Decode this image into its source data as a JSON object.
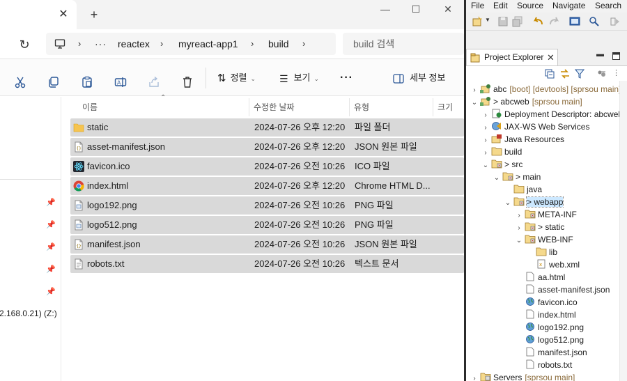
{
  "explorer": {
    "close_tab": "✕",
    "new_tab": "+",
    "window": {
      "minimize": "—",
      "maximize": "☐",
      "close": "✕"
    },
    "refresh": "↻",
    "breadcrumb": [
      "reactex",
      "myreact-app1",
      "build"
    ],
    "ellipsis": "···",
    "search_placeholder": "build 검색",
    "toolbar": {
      "sort": "정렬",
      "view": "보기",
      "more": "···",
      "details": "세부 정보"
    },
    "columns": {
      "name": "이름",
      "date": "수정한 날짜",
      "type": "유형",
      "size": "크기"
    },
    "files": [
      {
        "icon": "folder-icon",
        "name": "static",
        "date": "2024-07-26 오후 12:20",
        "type": "파일 폴더"
      },
      {
        "icon": "json-file-icon",
        "name": "asset-manifest.json",
        "date": "2024-07-26 오후 12:20",
        "type": "JSON 원본 파일"
      },
      {
        "icon": "react-icon",
        "name": "favicon.ico",
        "date": "2024-07-26 오전 10:26",
        "type": "ICO 파일"
      },
      {
        "icon": "chrome-icon",
        "name": "index.html",
        "date": "2024-07-26 오후 12:20",
        "type": "Chrome HTML D..."
      },
      {
        "icon": "image-file-icon",
        "name": "logo192.png",
        "date": "2024-07-26 오전 10:26",
        "type": "PNG 파일"
      },
      {
        "icon": "image-file-icon",
        "name": "logo512.png",
        "date": "2024-07-26 오전 10:26",
        "type": "PNG 파일"
      },
      {
        "icon": "json-file-icon",
        "name": "manifest.json",
        "date": "2024-07-26 오전 10:26",
        "type": "JSON 원본 파일"
      },
      {
        "icon": "text-file-icon",
        "name": "robots.txt",
        "date": "2024-07-26 오전 10:26",
        "type": "텍스트 문서"
      }
    ],
    "nav_drive": "2.168.0.21) (Z:)"
  },
  "eclipse": {
    "menu": [
      "File",
      "Edit",
      "Source",
      "Navigate",
      "Search"
    ],
    "view_title": "Project Explorer",
    "view_close": "✕",
    "tree": [
      {
        "indent": 0,
        "twisty": "›",
        "icon": "project-icon",
        "label": "abc",
        "decor": "[boot] [devtools] [sprsou main]"
      },
      {
        "indent": 0,
        "twisty": "⌄",
        "icon": "project-icon",
        "label": "> abcweb",
        "decor": "[sprsou main]"
      },
      {
        "indent": 1,
        "twisty": "›",
        "icon": "descriptor-icon",
        "label": "Deployment Descriptor: abcweb",
        "decor": ""
      },
      {
        "indent": 1,
        "twisty": "›",
        "icon": "webservices-icon",
        "label": "JAX-WS Web Services",
        "decor": ""
      },
      {
        "indent": 1,
        "twisty": "›",
        "icon": "java-resources-icon",
        "label": "Java Resources",
        "decor": ""
      },
      {
        "indent": 1,
        "twisty": "›",
        "icon": "folder-icon",
        "label": "build",
        "decor": ""
      },
      {
        "indent": 1,
        "twisty": "⌄",
        "icon": "folder-git-icon",
        "label": "> src",
        "decor": ""
      },
      {
        "indent": 2,
        "twisty": "⌄",
        "icon": "folder-git-icon",
        "label": "> main",
        "decor": ""
      },
      {
        "indent": 3,
        "twisty": "",
        "icon": "folder-icon",
        "label": "java",
        "decor": ""
      },
      {
        "indent": 3,
        "twisty": "⌄",
        "icon": "folder-git-icon",
        "label": "> webapp",
        "decor": "",
        "selected": true
      },
      {
        "indent": 4,
        "twisty": "›",
        "icon": "folder-git-icon",
        "label": "META-INF",
        "decor": ""
      },
      {
        "indent": 4,
        "twisty": "›",
        "icon": "folder-git-icon",
        "label": "> static",
        "decor": ""
      },
      {
        "indent": 4,
        "twisty": "⌄",
        "icon": "folder-git-icon",
        "label": "WEB-INF",
        "decor": ""
      },
      {
        "indent": 5,
        "twisty": "",
        "icon": "folder-icon",
        "label": "lib",
        "decor": ""
      },
      {
        "indent": 5,
        "twisty": "",
        "icon": "xml-file-icon",
        "label": "web.xml",
        "decor": ""
      },
      {
        "indent": 4,
        "twisty": "",
        "icon": "file-icon",
        "label": "aa.html",
        "decor": ""
      },
      {
        "indent": 4,
        "twisty": "",
        "icon": "file-icon",
        "label": "asset-manifest.json",
        "decor": ""
      },
      {
        "indent": 4,
        "twisty": "",
        "icon": "globe-file-icon",
        "label": "favicon.ico",
        "decor": ""
      },
      {
        "indent": 4,
        "twisty": "",
        "icon": "file-icon",
        "label": "index.html",
        "decor": ""
      },
      {
        "indent": 4,
        "twisty": "",
        "icon": "globe-file-icon",
        "label": "logo192.png",
        "decor": ""
      },
      {
        "indent": 4,
        "twisty": "",
        "icon": "globe-file-icon",
        "label": "logo512.png",
        "decor": ""
      },
      {
        "indent": 4,
        "twisty": "",
        "icon": "file-icon",
        "label": "manifest.json",
        "decor": ""
      },
      {
        "indent": 4,
        "twisty": "",
        "icon": "file-icon",
        "label": "robots.txt",
        "decor": ""
      },
      {
        "indent": 0,
        "twisty": "›",
        "icon": "servers-icon",
        "label": "Servers",
        "decor": "[sprsou main]"
      }
    ]
  }
}
